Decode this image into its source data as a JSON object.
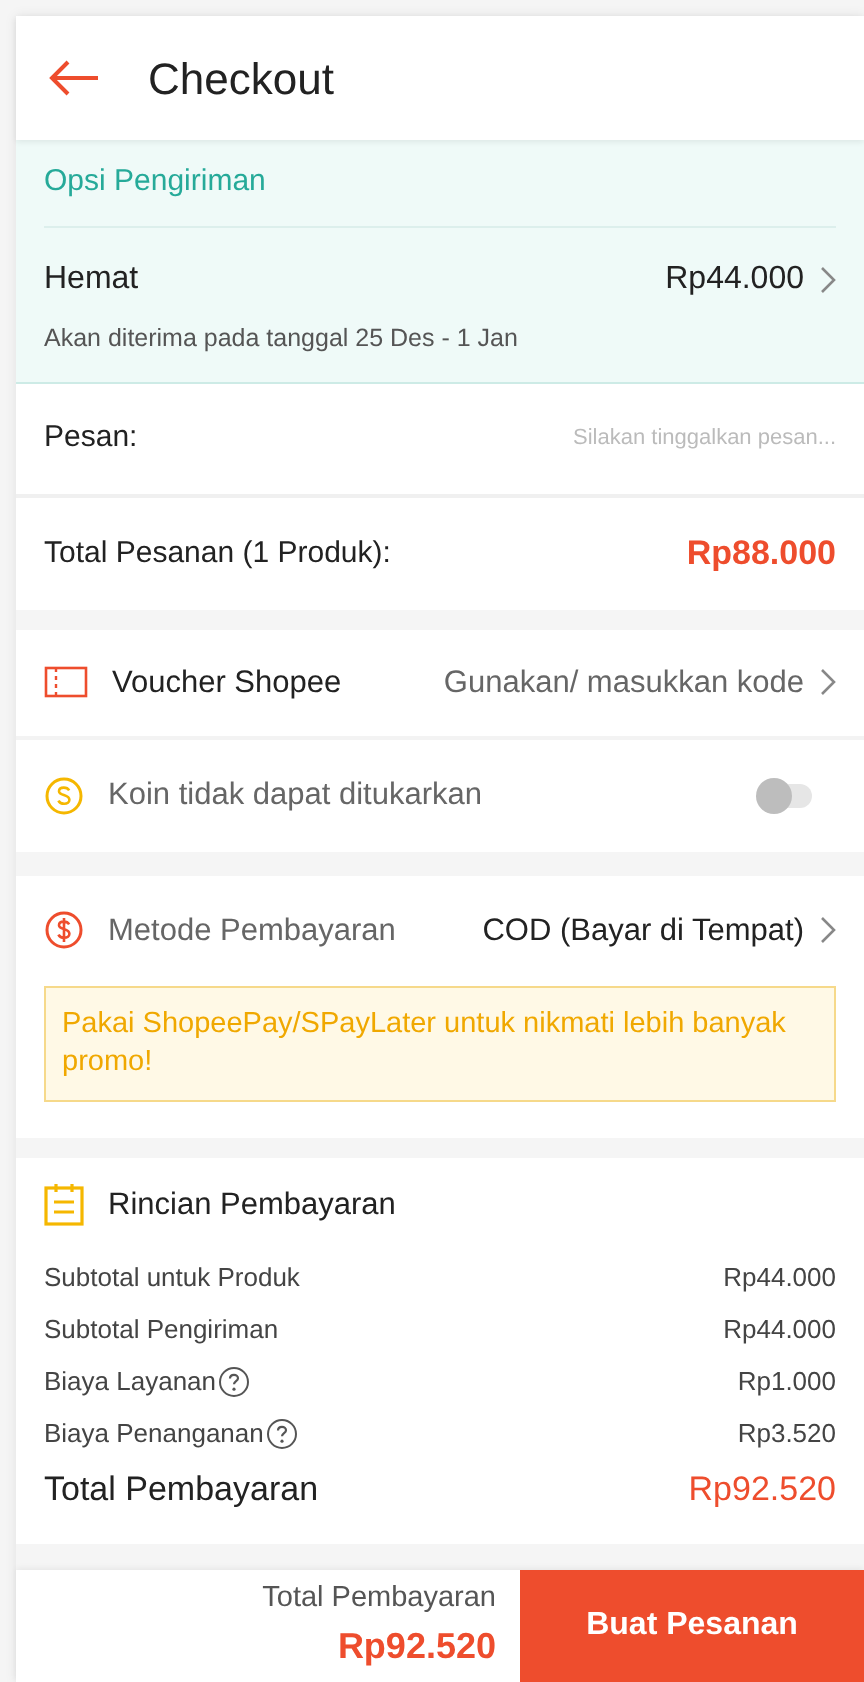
{
  "header": {
    "title": "Checkout"
  },
  "shipping": {
    "heading": "Opsi Pengiriman",
    "option": "Hemat",
    "price": "Rp44.000",
    "eta": "Akan diterima pada tanggal 25 Des - 1 Jan"
  },
  "message": {
    "label": "Pesan:",
    "placeholder": "Silakan tinggalkan pesan..."
  },
  "order_total": {
    "label": "Total Pesanan (1 Produk):",
    "value": "Rp88.000"
  },
  "voucher": {
    "label": "Voucher Shopee",
    "value": "Gunakan/ masukkan kode"
  },
  "coins": {
    "label": "Koin tidak dapat ditukarkan",
    "on": false
  },
  "payment": {
    "label": "Metode Pembayaran",
    "value": "COD (Bayar di Tempat)",
    "notice": "Pakai ShopeePay/SPayLater untuk nikmati lebih banyak promo!"
  },
  "details": {
    "heading": "Rincian Pembayaran",
    "rows": [
      {
        "label": "Subtotal untuk Produk",
        "value": "Rp44.000",
        "help": false
      },
      {
        "label": "Subtotal Pengiriman",
        "value": "Rp44.000",
        "help": false
      },
      {
        "label": "Biaya Layanan",
        "value": "Rp1.000",
        "help": true
      },
      {
        "label": "Biaya Penanganan",
        "value": "Rp3.520",
        "help": true
      }
    ],
    "total_label": "Total Pembayaran",
    "total_value": "Rp92.520"
  },
  "footer": {
    "label": "Total Pembayaran",
    "value": "Rp92.520",
    "button": "Buat Pesanan"
  }
}
